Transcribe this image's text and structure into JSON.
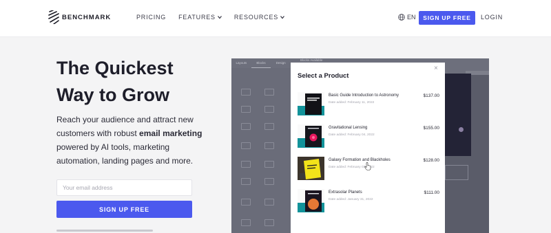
{
  "brand": {
    "name": "BENCHMARK"
  },
  "nav": {
    "items": [
      {
        "label": "PRICING",
        "has_dropdown": false
      },
      {
        "label": "FEATURES",
        "has_dropdown": true
      },
      {
        "label": "RESOURCES",
        "has_dropdown": true
      }
    ],
    "language": "EN",
    "cta_label": "SIGN UP FREE",
    "login_label": "LOGIN"
  },
  "hero": {
    "title_line1": "The Quickest",
    "title_line2": "Way to Grow",
    "body_before": "Reach your audience and attract new customers with robust ",
    "body_strong": "email marketing",
    "body_after": " powered by AI tools, marketing automation, landing pages and more.",
    "email_placeholder": "Your email address",
    "cta_label": "SIGN UP FREE"
  },
  "editor": {
    "tabs": [
      "Layouts",
      "Blocks",
      "Design"
    ],
    "canvas_label": "Blocks Available"
  },
  "modal": {
    "title": "Select a Product",
    "close_label": "×",
    "products": [
      {
        "name": "Basic Guide Introduction to Astronomy",
        "date": "Date added: February 11, 2022",
        "price": "$137.00",
        "thumb": "astronomy-book-cover"
      },
      {
        "name": "Gravitational Lensing",
        "date": "Date added: February 04, 2022",
        "price": "$155.00",
        "thumb": "gravitational-lensing-cover"
      },
      {
        "name": "Galaxy Formation and Blackholes",
        "date": "Date added: February 03, 2022",
        "price": "$128.00",
        "thumb": "galaxy-formation-cover"
      },
      {
        "name": "Extrasolar Planets",
        "date": "Date added: January 31, 2022",
        "price": "$111.00",
        "thumb": "extrasolar-planets-cover"
      }
    ]
  },
  "colors": {
    "accent": "#4b59ee",
    "text_dark": "#1e1e2a",
    "page_bg": "#f4f4f5",
    "overlay": "#6d6f7c",
    "teal": "#12939a"
  }
}
